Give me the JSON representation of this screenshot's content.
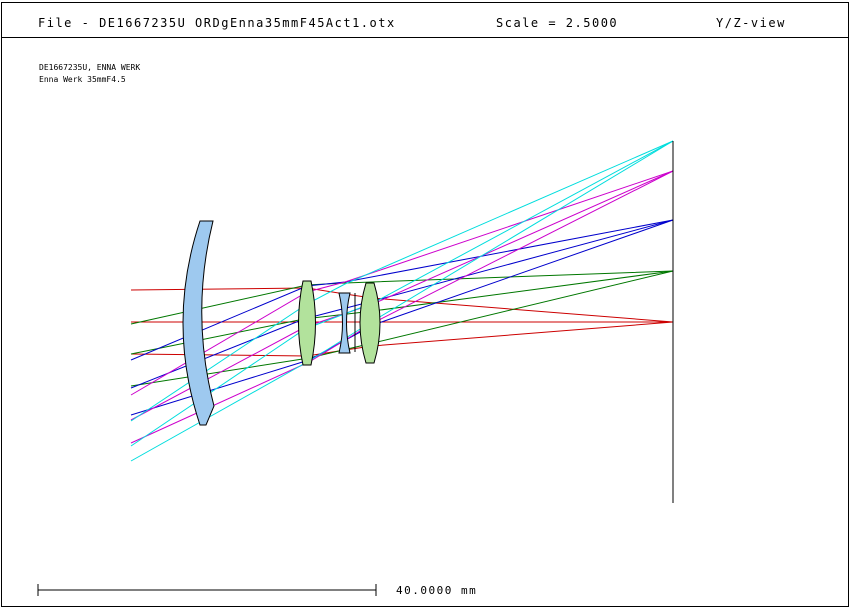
{
  "header": {
    "file_text": "File - DE1667235U ORDgEnna35mmF45Act1.otx",
    "scale_text": "Scale = 2.5000",
    "view_text": "Y/Z-view"
  },
  "design": {
    "line1": "DE1667235U, ENNA WERK",
    "line2": "Enna Werk 35mmF4.5"
  },
  "scale_bar": {
    "label": "40.0000 mm"
  },
  "colors": {
    "ray_axis": "#cc0000",
    "ray_field1": "#007700",
    "ray_field2": "#0000cc",
    "ray_field3": "#cc00cc",
    "ray_field4": "#00dddd",
    "lens_flint": "#9ec9ef",
    "lens_crown": "#b2e29c",
    "ink": "#000000"
  }
}
